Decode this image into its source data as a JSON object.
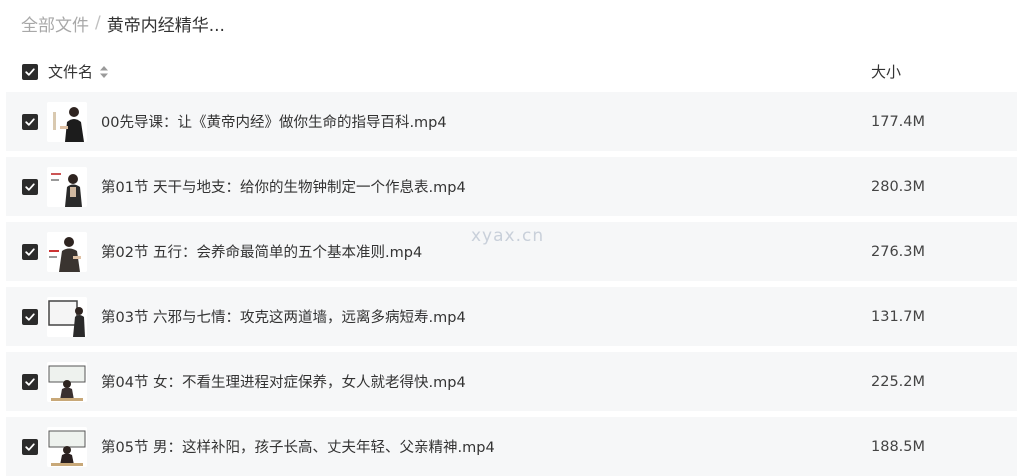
{
  "breadcrumb": {
    "root": "全部文件",
    "separator": "/",
    "current": "黄帝内经精华..."
  },
  "header": {
    "name_label": "文件名",
    "size_label": "大小"
  },
  "files": [
    {
      "name": "00先导课：让《黄帝内经》做你生命的指导百科.mp4",
      "size": "177.4M"
    },
    {
      "name": "第01节 天干与地支：给你的生物钟制定一个作息表.mp4",
      "size": "280.3M"
    },
    {
      "name": "第02节 五行：会养命最简单的五个基本准则.mp4",
      "size": "276.3M"
    },
    {
      "name": "第03节 六邪与七情：攻克这两道墙，远离多病短寿.mp4",
      "size": "131.7M"
    },
    {
      "name": "第04节 女：不看生理进程对症保养，女人就老得快.mp4",
      "size": "225.2M"
    },
    {
      "name": "第05节 男：这样补阳，孩子长高、丈夫年轻、父亲精神.mp4",
      "size": "188.5M"
    }
  ],
  "watermark": "xyax.cn",
  "colors": {
    "checkbox": "#2b2b2b",
    "row_background": "#f6f7f8",
    "breadcrumb_root": "#a8a8a8"
  }
}
